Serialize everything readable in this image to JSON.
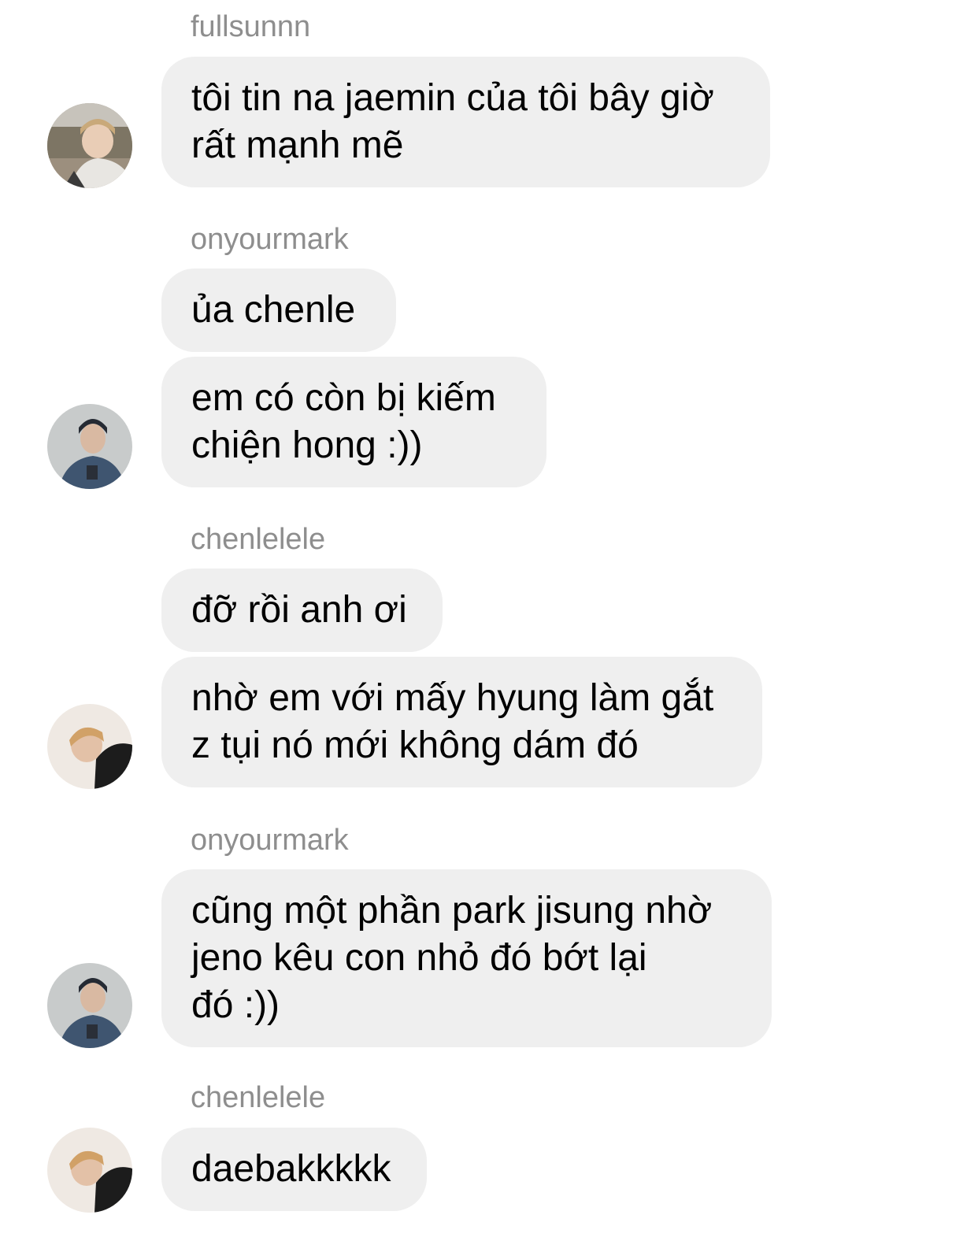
{
  "thread": {
    "groups": [
      {
        "username": "fullsunnn",
        "avatar_icon": "user-avatar-photo-outdoor",
        "messages": [
          [
            "tôi tin na jaemin của tôi bây giờ",
            "rất mạnh mẽ"
          ]
        ]
      },
      {
        "username": "onyourmark",
        "avatar_icon": "user-avatar-photo-beanie",
        "messages": [
          [
            "ủa chenle"
          ],
          [
            "em có còn bị kiếm",
            "chiện hong :))"
          ]
        ]
      },
      {
        "username": "chenlelele",
        "avatar_icon": "user-avatar-photo-lying",
        "messages": [
          [
            "đỡ rồi anh ơi"
          ],
          [
            "nhờ em với mấy hyung làm gắt",
            "z tụi nó mới không dám đó"
          ]
        ]
      },
      {
        "username": "onyourmark",
        "avatar_icon": "user-avatar-photo-beanie",
        "messages": [
          [
            "cũng một phần park jisung nhờ",
            "jeno kêu con nhỏ đó bớt lại",
            "đó :))"
          ]
        ]
      },
      {
        "username": "chenlelele",
        "avatar_icon": "user-avatar-photo-lying",
        "messages": [
          [
            "daebakkkkk"
          ]
        ]
      }
    ]
  },
  "colors": {
    "bubble_background": "#efefef",
    "username_text": "#8e8e8e",
    "message_text": "#000000"
  }
}
